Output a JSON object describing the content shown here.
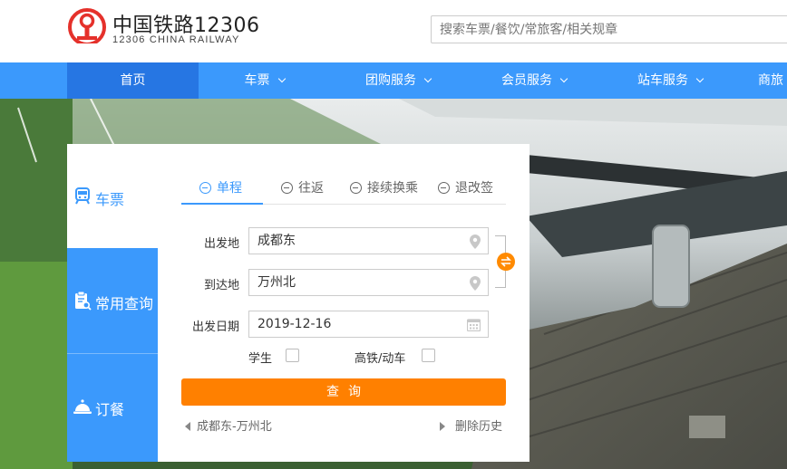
{
  "header": {
    "logo_title": "中国铁路12306",
    "logo_subtitle": "12306 CHINA RAILWAY",
    "search_placeholder": "搜索车票/餐饮/常旅客/相关规章"
  },
  "nav": {
    "items": [
      {
        "label": "首页",
        "has_dropdown": false,
        "active": true
      },
      {
        "label": "车票",
        "has_dropdown": true
      },
      {
        "label": "团购服务",
        "has_dropdown": true
      },
      {
        "label": "会员服务",
        "has_dropdown": true
      },
      {
        "label": "站车服务",
        "has_dropdown": true
      },
      {
        "label": "商旅"
      }
    ]
  },
  "sidebar": {
    "items": [
      {
        "label": "车票",
        "icon": "train-icon",
        "active": true
      },
      {
        "label": "常用查询",
        "icon": "clipboard-search-icon"
      },
      {
        "label": "订餐",
        "icon": "food-cloche-icon"
      }
    ]
  },
  "tabs": [
    {
      "label": "单程",
      "active": true
    },
    {
      "label": "往返"
    },
    {
      "label": "接续换乘"
    },
    {
      "label": "退改签"
    }
  ],
  "form": {
    "from_label": "出发地",
    "from_value": "成都东",
    "to_label": "到达地",
    "to_value": "万州北",
    "date_label": "出发日期",
    "date_value": "2019-12-16",
    "student_label": "学生",
    "highspeed_label": "高铁/动车",
    "query_label": "查询"
  },
  "history": {
    "recent": "成都东-万州北",
    "clear_label": "删除历史"
  },
  "colors": {
    "nav_blue": "#3b99fc",
    "nav_active": "#2676e3",
    "accent_orange": "#ff8000",
    "logo_red": "#e5312b"
  }
}
